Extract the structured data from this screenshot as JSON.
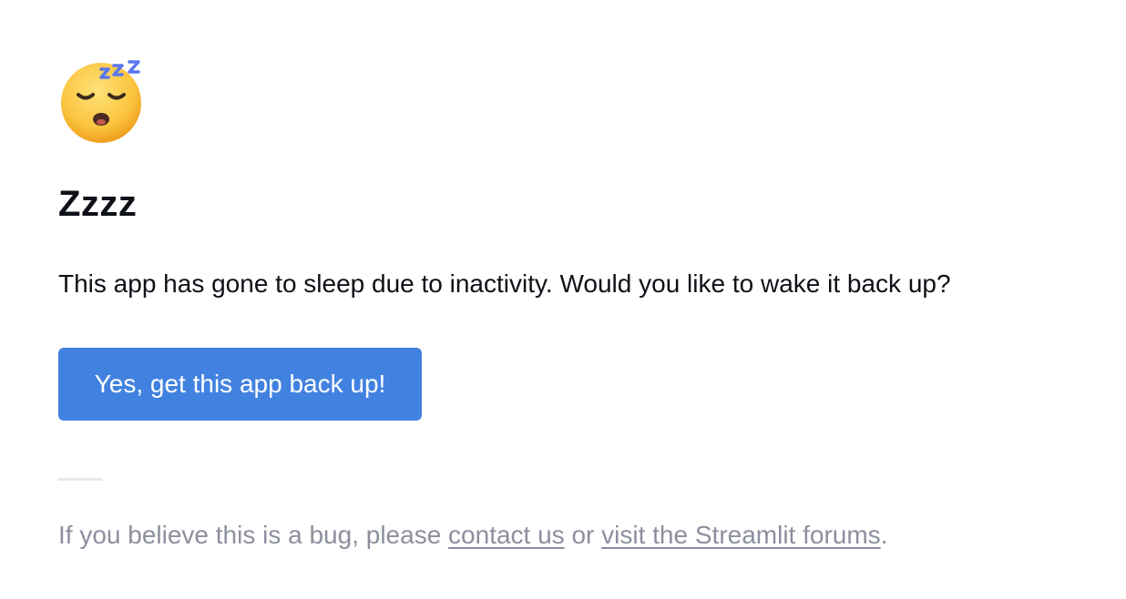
{
  "sleep_page": {
    "icon": "sleeping-face-icon",
    "title": "Zzzz",
    "message": "This app has gone to sleep due to inactivity. Would you like to wake it back up?",
    "wake_button_label": "Yes, get this app back up!",
    "footer": {
      "prefix": "If you believe this is a bug, please ",
      "contact_link": "contact us",
      "middle": " or ",
      "forums_link": "visit the Streamlit forums",
      "suffix": "."
    }
  },
  "colors": {
    "button_background": "#4182e0",
    "button_text": "#ffffff",
    "body_text": "#0e1117",
    "muted_text": "#8c8f9e",
    "divider": "#e6e8ee",
    "emoji_face": "#fbc43f",
    "zzz": "#5a77f0"
  }
}
